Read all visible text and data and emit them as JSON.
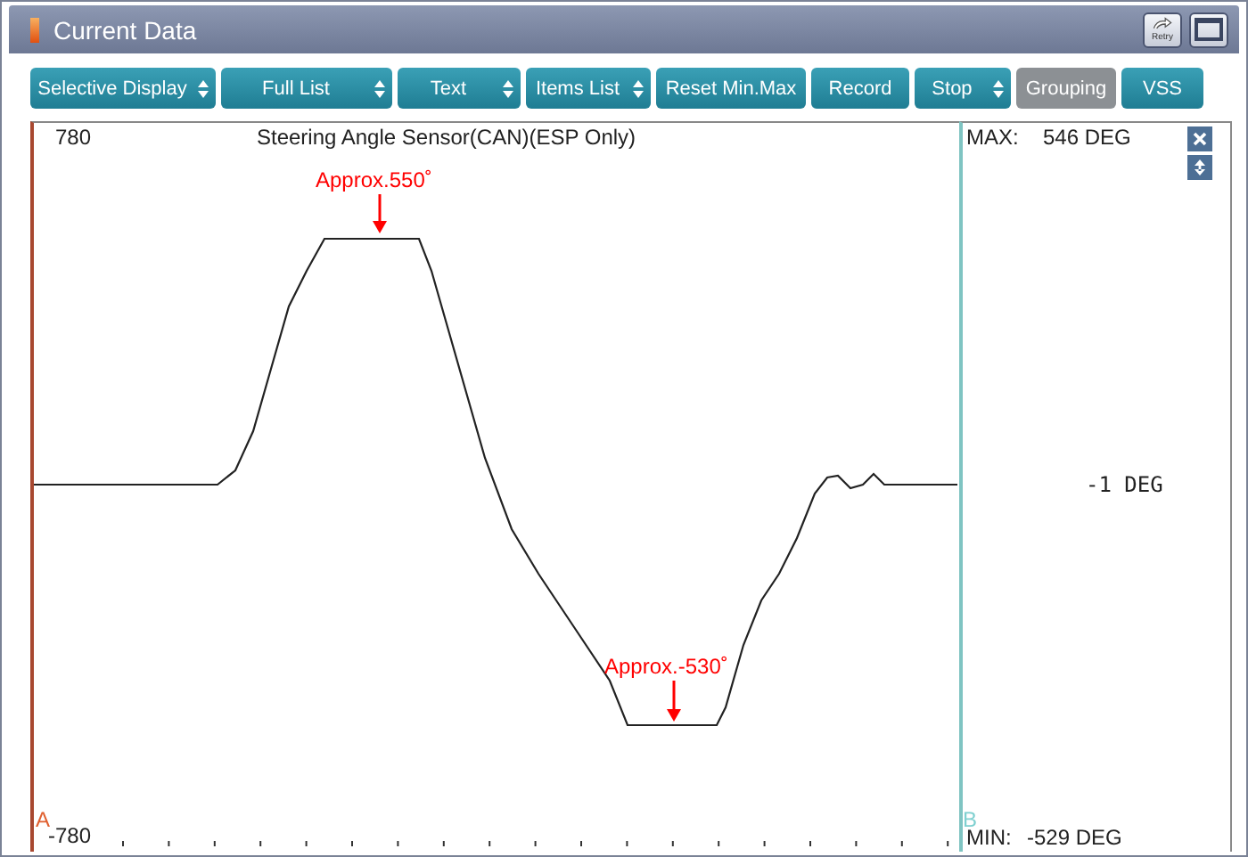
{
  "window": {
    "title": "Current Data",
    "retry_label": "Retry"
  },
  "toolbar": [
    {
      "label": "Selective Display",
      "kind": "dropdown",
      "disabled": false
    },
    {
      "label": "Full List",
      "kind": "dropdown",
      "disabled": false
    },
    {
      "label": "Text",
      "kind": "dropdown",
      "disabled": false
    },
    {
      "label": "Items List",
      "kind": "dropdown",
      "disabled": false
    },
    {
      "label": "Reset Min.Max",
      "kind": "plain",
      "disabled": false
    },
    {
      "label": "Record",
      "kind": "plain",
      "disabled": false
    },
    {
      "label": "Stop",
      "kind": "dropdown",
      "disabled": false
    },
    {
      "label": "Grouping",
      "kind": "plain",
      "disabled": true
    },
    {
      "label": "VSS",
      "kind": "plain",
      "disabled": false
    }
  ],
  "graph": {
    "scale_max": "780",
    "title": "Steering Angle Sensor(CAN)(ESP Only)",
    "scale_min": "-780",
    "cursor_a": "A",
    "annotations": [
      {
        "text": "Approx.550˚"
      },
      {
        "text": "Approx.-530˚"
      }
    ]
  },
  "readout": {
    "max_label": "MAX:",
    "max_value": "546 DEG",
    "current": "-1 DEG",
    "cursor_b": "B",
    "min_label": "MIN:",
    "min_value": "-529 DEG"
  }
}
